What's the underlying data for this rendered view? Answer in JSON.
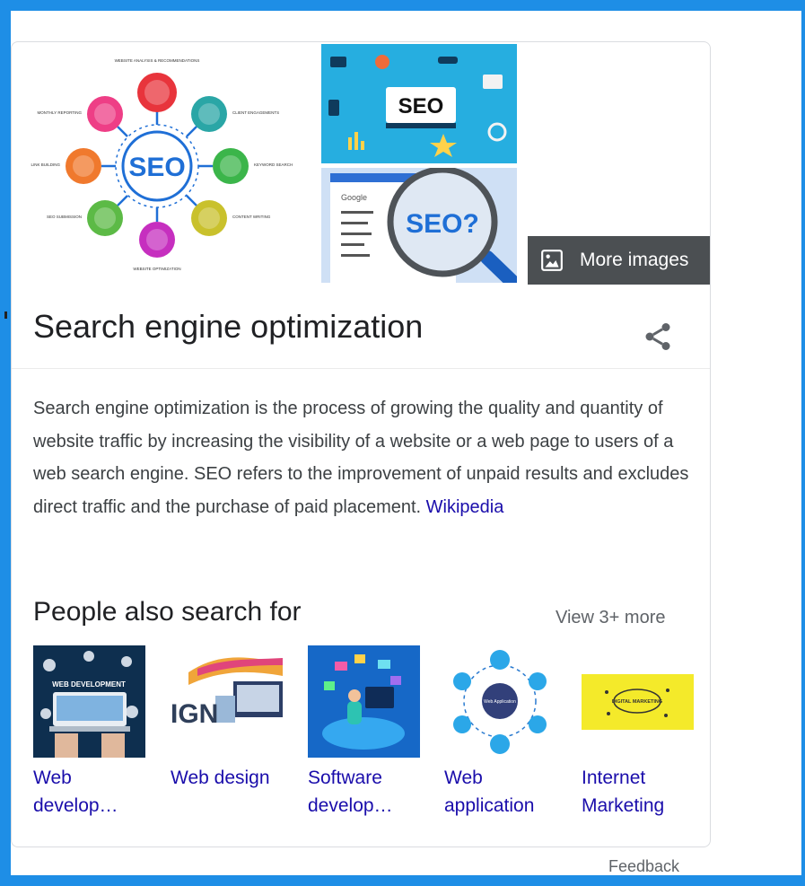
{
  "images": {
    "main_center": "SEO",
    "main_nodes": [
      "WEBSITE ANALYSIS & RECOMMENDATIONS",
      "CLIENT ENGAGEMENTS",
      "KEYWORD SEARCH",
      "CONTENT WRITING",
      "WEBSITE OPTIMIZATION",
      "SEO SUBMISSION",
      "LINK BUILDING",
      "MONTHLY REPORTING"
    ],
    "top_right_label": "SEO",
    "bottom_right_label": "SEO?",
    "bottom_right_search": "Google",
    "more_images_label": "More images"
  },
  "entity": {
    "title": "Search engine optimization",
    "description": "Search engine optimization is the process of growing the quality and quantity of website traffic by increasing the visibility of a website or a web page to users of a web search engine. SEO refers to the improvement of unpaid results and excludes direct traffic and the purchase of paid placement.",
    "source_link": "Wikipedia"
  },
  "people_also_search": {
    "title": "People also search for",
    "view_more": "View 3+ more",
    "items": [
      {
        "label": "Web develop…",
        "thumb_text": "WEB DEVELOPMENT"
      },
      {
        "label": "Web design",
        "thumb_text": "IGN"
      },
      {
        "label": "Software develop…"
      },
      {
        "label": "Web application",
        "thumb_text": "Web Application"
      },
      {
        "label": "Internet Marketing",
        "thumb_text": "DIGITAL MARKETING"
      }
    ]
  },
  "footer": {
    "feedback": "Feedback"
  },
  "colors": {
    "frame": "#1e8ee6",
    "link": "#1a0dab",
    "title": "#202124",
    "body_text": "#3c4043",
    "muted": "#5f6368"
  }
}
